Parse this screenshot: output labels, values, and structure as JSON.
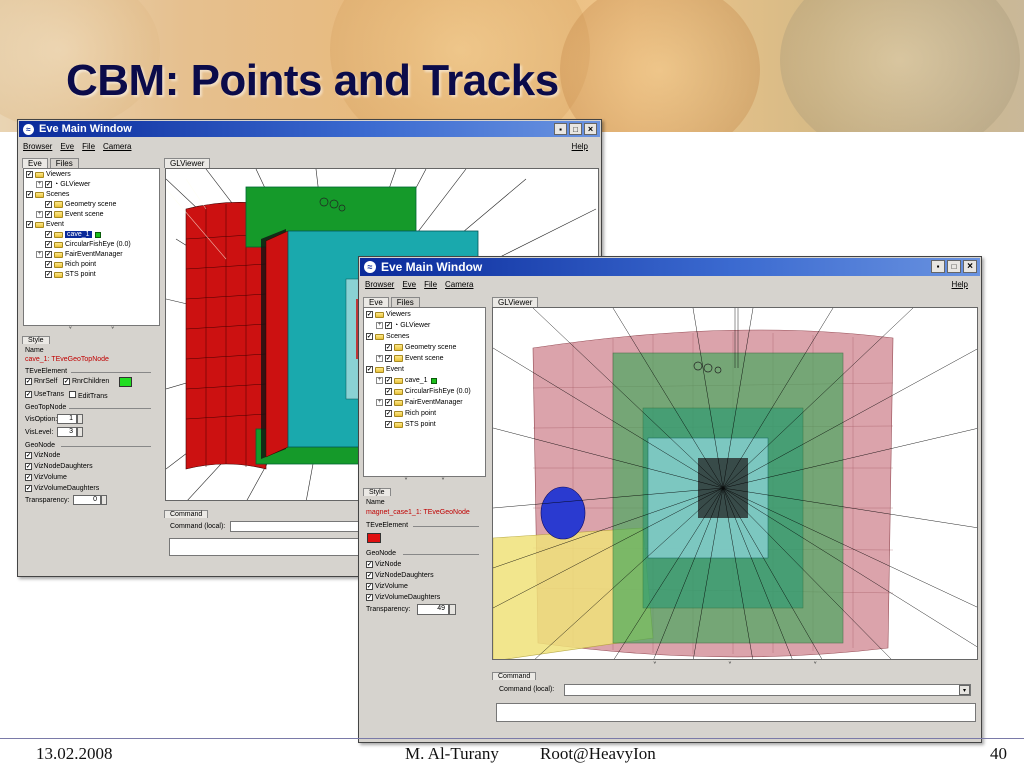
{
  "slide": {
    "title": "CBM: Points and Tracks",
    "footer_date": "13.02.2008",
    "footer_author": "M. Al-Turany",
    "footer_event": "Root@HeavyIon",
    "footer_page": "40"
  },
  "window_back": {
    "title": "Eve Main Window",
    "menu": [
      "Browser",
      "Eve",
      "File",
      "Camera"
    ],
    "help": "Help",
    "left_tabs": [
      "Eve",
      "Files"
    ],
    "viewer_tab": "GLViewer",
    "tree": [
      {
        "label": "Viewers"
      },
      {
        "label": "GLViewer"
      },
      {
        "label": "Scenes"
      },
      {
        "label": "Geometry scene"
      },
      {
        "label": "Event scene"
      },
      {
        "label": "Event"
      },
      {
        "label": "cave_1"
      },
      {
        "label": "CircularFishEye (0.0)"
      },
      {
        "label": "FairEventManager"
      },
      {
        "label": "Rich point"
      },
      {
        "label": "STS point"
      }
    ],
    "editor": {
      "tab": "Style",
      "name_label": "Name",
      "name_value": "cave_1: TEveGeoTopNode",
      "element_group": "TEveElement",
      "rnr_self": "RnrSelf",
      "rnr_children": "RnrChildren",
      "use_trans": "UseTrans",
      "edit_trans": "EditTrans",
      "geotopnode_group": "GeoTopNode",
      "vis_option_label": "VisOption:",
      "vis_option_value": "1",
      "vis_level_label": "VisLevel:",
      "vis_level_value": "3",
      "geonode_group": "GeoNode",
      "viz_node": "VizNode",
      "viz_node_daughters": "VizNodeDaughters",
      "viz_volume": "VizVolume",
      "viz_volume_daughters": "VizVolumeDaughters",
      "transparency_label": "Transparency:",
      "transparency_value": "0",
      "color": "#22dd22"
    },
    "command_tab": "Command",
    "command_label": "Command (local):"
  },
  "window_front": {
    "title": "Eve Main Window",
    "menu": [
      "Browser",
      "Eve",
      "File",
      "Camera"
    ],
    "help": "Help",
    "left_tabs": [
      "Eve",
      "Files"
    ],
    "viewer_tab": "GLViewer",
    "tree": [
      {
        "label": "Viewers"
      },
      {
        "label": "GLViewer"
      },
      {
        "label": "Scenes"
      },
      {
        "label": "Geometry scene"
      },
      {
        "label": "Event scene"
      },
      {
        "label": "Event"
      },
      {
        "label": "cave_1"
      },
      {
        "label": "CircularFishEye (0.0)"
      },
      {
        "label": "FairEventManager"
      },
      {
        "label": "Rich point"
      },
      {
        "label": "STS point"
      }
    ],
    "editor": {
      "tab": "Style",
      "name_label": "Name",
      "name_value": "magnet_case1_1: TEveGeoNode",
      "element_group": "TEveElement",
      "geonode_group": "GeoNode",
      "viz_node": "VizNode",
      "viz_node_daughters": "VizNodeDaughters",
      "viz_volume": "VizVolume",
      "viz_volume_daughters": "VizVolumeDaughters",
      "transparency_label": "Transparency:",
      "transparency_value": "49",
      "color": "#e01010"
    },
    "command_tab": "Command",
    "command_label": "Command (local):"
  },
  "colors": {
    "title_text": "#0b0b4a",
    "titlebar_blue": "#0a2a9a",
    "detector_red": "#cc1111",
    "detector_green": "#159a2a",
    "detector_cyan": "#1aa9ad",
    "detector_pink": "#d89aa2",
    "detector_yellow": "#f0e27a"
  },
  "icons": {
    "window_icon": "eve-app-icon",
    "minimize": "minimize-icon",
    "maximize": "maximize-icon",
    "close": "close-icon",
    "folder": "folder-icon",
    "checkbox": "checkbox-icon",
    "expand": "expand-icon"
  }
}
